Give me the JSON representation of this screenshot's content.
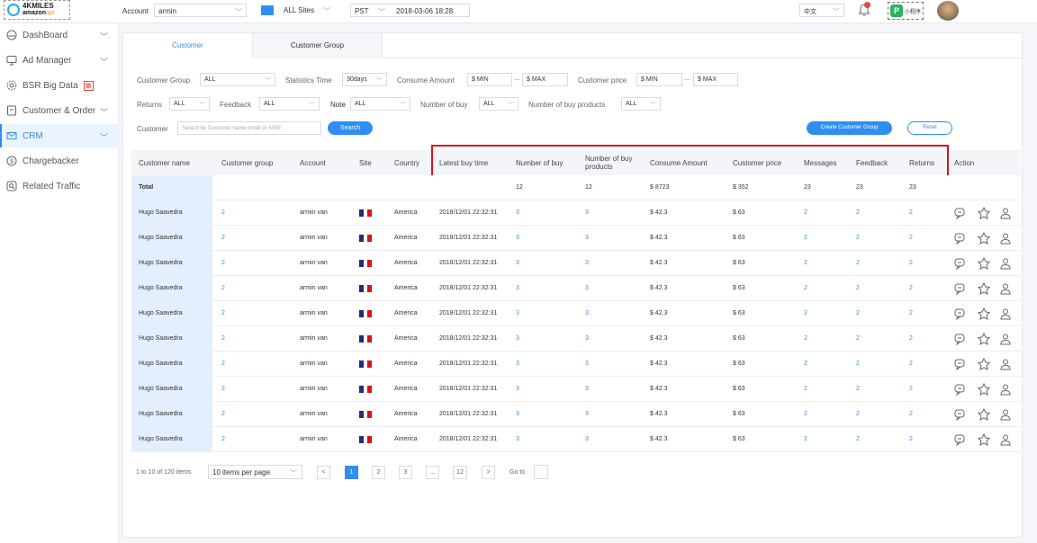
{
  "topbar": {
    "logo_line1": "4KMILES",
    "logo_line2": "amazon",
    "logo_line2_suffix": "api",
    "account_label": "Account",
    "account_value": "armin",
    "sites_value": "ALL Sites",
    "timezone_value": "PST",
    "datetime": "2018-03-06 18:28",
    "language": "中文",
    "mini_program": "小程序"
  },
  "sidebar": {
    "items": [
      {
        "label": "DashBoard",
        "icon": "dashboard-icon",
        "chevron": true
      },
      {
        "label": "Ad Manager",
        "icon": "monitor-icon",
        "chevron": true
      },
      {
        "label": "BSR Big Data",
        "icon": "gear-icon",
        "chevron": false
      },
      {
        "label": "Customer & Order",
        "icon": "document-icon",
        "chevron": true
      },
      {
        "label": "CRM",
        "icon": "mail-icon",
        "chevron": true
      },
      {
        "label": "Chargebacker",
        "icon": "dollar-icon",
        "chevron": false
      },
      {
        "label": "Related Traffic",
        "icon": "search-icon",
        "chevron": false
      }
    ]
  },
  "tabs": [
    {
      "label": "Customer"
    },
    {
      "label": "Customer Group"
    }
  ],
  "filters": {
    "customer_group_label": "Customer Group",
    "customer_group_value": "ALL",
    "statistics_time_label": "Statistics Time",
    "statistics_time_value": "30days",
    "consume_amount_label": "Consume Amount",
    "consume_min": "$ MIN",
    "consume_max": "$ MAX",
    "customer_price_label": "Customer price",
    "price_min": "$ MIN",
    "price_max": "$ MAX",
    "returns_label": "Returns",
    "returns_value": "ALL",
    "feedback_label": "Feedback",
    "feedback_value": "ALL",
    "note_label": "Note",
    "note_value": "ALL",
    "number_of_buy_label": "Number of buy",
    "number_of_buy_value": "ALL",
    "number_of_buy_products_label": "Number of buy products",
    "number_of_buy_products_value": "ALL",
    "customer_label": "Customer",
    "customer_placeholder": "Serach by Customer name email or ASIN",
    "search_button": "Search",
    "create_button": "Create Customer Group",
    "reset_button": "Reset"
  },
  "table": {
    "columns": [
      "Customer name",
      "Customer group",
      "Account",
      "Site",
      "Country",
      "Latest buy time",
      "Number of buy",
      "Number of buy products",
      "Consume Amount",
      "Customer price",
      "Messages",
      "Feedback",
      "Returns",
      "Action"
    ],
    "total": {
      "label": "Total",
      "number_of_buy": "12",
      "number_of_buy_products": "12",
      "consume_amount": "$ 8723",
      "customer_price": "$ 352",
      "messages": "23",
      "feedback": "23",
      "returns": "23"
    },
    "rows": [
      {
        "name": "Hugo Saavedra",
        "group": "2",
        "account": "armin van",
        "country": "America",
        "latest": "2018/12/01 22:32:31",
        "buys": "3",
        "products": "3",
        "amount": "$ 42.3",
        "price": "$ 63",
        "messages": "2",
        "feedback": "2",
        "returns": "2"
      },
      {
        "name": "Hugo Saavedra",
        "group": "2",
        "account": "armin van",
        "country": "America",
        "latest": "2018/12/01 22:32:31",
        "buys": "3",
        "products": "3",
        "amount": "$ 42.3",
        "price": "$ 63",
        "messages": "2",
        "feedback": "2",
        "returns": "2"
      },
      {
        "name": "Hugo Saavedra",
        "group": "2",
        "account": "armin van",
        "country": "America",
        "latest": "2018/12/01 22:32:31",
        "buys": "3",
        "products": "3",
        "amount": "$ 42.3",
        "price": "$ 63",
        "messages": "2",
        "feedback": "2",
        "returns": "2"
      },
      {
        "name": "Hugo Saavedra",
        "group": "2",
        "account": "armin van",
        "country": "America",
        "latest": "2018/12/01 22:32:31",
        "buys": "3",
        "products": "3",
        "amount": "$ 42.3",
        "price": "$ 63",
        "messages": "2",
        "feedback": "2",
        "returns": "2"
      },
      {
        "name": "Hugo Saavedra",
        "group": "2",
        "account": "armin van",
        "country": "America",
        "latest": "2018/12/01 22:32:31",
        "buys": "3",
        "products": "3",
        "amount": "$ 42.3",
        "price": "$ 63",
        "messages": "2",
        "feedback": "2",
        "returns": "2"
      },
      {
        "name": "Hugo Saavedra",
        "group": "2",
        "account": "armin van",
        "country": "America",
        "latest": "2018/12/01 22:32:31",
        "buys": "3",
        "products": "3",
        "amount": "$ 42.3",
        "price": "$ 63",
        "messages": "2",
        "feedback": "2",
        "returns": "2"
      },
      {
        "name": "Hugo Saavedra",
        "group": "2",
        "account": "armin van",
        "country": "America",
        "latest": "2018/12/01 22:32:31",
        "buys": "3",
        "products": "3",
        "amount": "$ 42.3",
        "price": "$ 63",
        "messages": "2",
        "feedback": "2",
        "returns": "2"
      },
      {
        "name": "Hugo Saavedra",
        "group": "2",
        "account": "armin van",
        "country": "America",
        "latest": "2018/12/01 22:32:31",
        "buys": "3",
        "products": "3",
        "amount": "$ 42.3",
        "price": "$ 63",
        "messages": "2",
        "feedback": "2",
        "returns": "2"
      },
      {
        "name": "Hugo Saavedra",
        "group": "2",
        "account": "armin van",
        "country": "America",
        "latest": "2018/12/01 22:32:31",
        "buys": "3",
        "products": "3",
        "amount": "$ 42.3",
        "price": "$ 63",
        "messages": "2",
        "feedback": "2",
        "returns": "2"
      },
      {
        "name": "Hugo Saavedra",
        "group": "2",
        "account": "armin van",
        "country": "America",
        "latest": "2018/12/01 22:32:31",
        "buys": "3",
        "products": "3",
        "amount": "$ 42.3",
        "price": "$ 63",
        "messages": "2",
        "feedback": "2",
        "returns": "2"
      }
    ],
    "action_icons": [
      "message-icon",
      "pin-icon",
      "user-group-icon"
    ]
  },
  "pagination": {
    "range_text": "1 to 10 of 120 items",
    "page_size": "10 items per page",
    "pages": [
      "1",
      "2",
      "3",
      "...",
      "12"
    ],
    "current_page": "1",
    "prev": "<",
    "next": ">",
    "goto_label": "Go to"
  },
  "colors": {
    "accent": "#2f8ef0",
    "highlight_border": "#d4151b",
    "name_cell_bg": "#e3effd",
    "flag_blue": "#1d2e7a",
    "flag_red": "#d4151b"
  }
}
